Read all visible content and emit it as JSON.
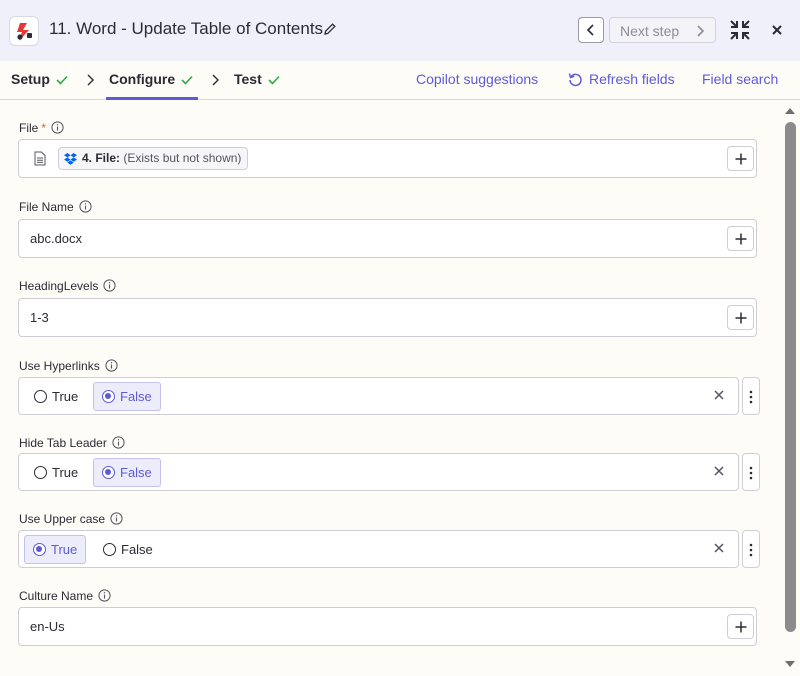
{
  "header": {
    "title": "11. Word - Update Table of Contents",
    "next_step_label": "Next step",
    "brand_color": "#e53935"
  },
  "tabs": [
    {
      "label": "Setup"
    },
    {
      "label": "Configure"
    },
    {
      "label": "Test"
    }
  ],
  "links": {
    "copilot": "Copilot suggestions",
    "refresh": "Refresh fields",
    "field_search": "Field search"
  },
  "fields": {
    "file": {
      "label": "File",
      "required_mark": "*",
      "chip_step": "4. File:",
      "chip_note": "(Exists but not shown)"
    },
    "file_name": {
      "label": "File Name",
      "value": "abc.docx"
    },
    "heading_levels": {
      "label": "HeadingLevels",
      "value": "1-3"
    },
    "use_hyperlinks": {
      "label": "Use Hyperlinks",
      "options": [
        "True",
        "False"
      ],
      "selected": "False"
    },
    "hide_tab_leader": {
      "label": "Hide Tab Leader",
      "options": [
        "True",
        "False"
      ],
      "selected": "False"
    },
    "use_upper_case": {
      "label": "Use Upper case",
      "options": [
        "True",
        "False"
      ],
      "selected": "True"
    },
    "culture_name": {
      "label": "Culture Name",
      "value": "en-Us"
    }
  },
  "colors": {
    "accent": "#5e5ad8",
    "success": "#2ea84a",
    "required": "#e5572d"
  }
}
